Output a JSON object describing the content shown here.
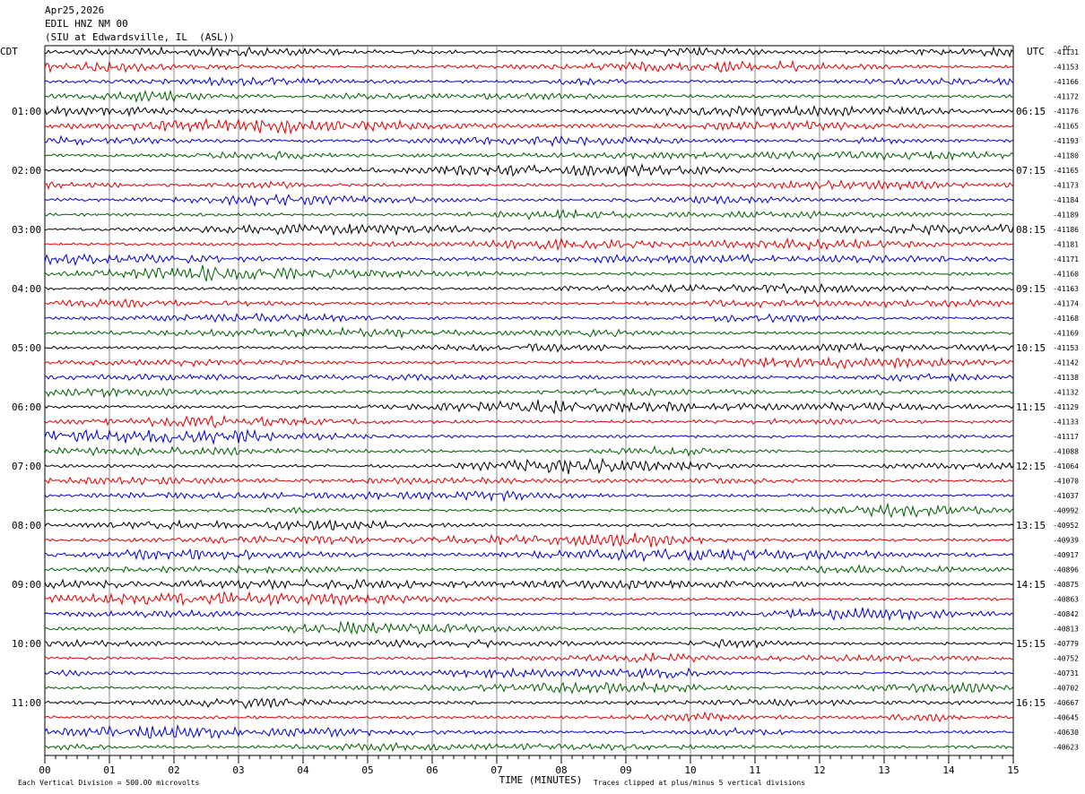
{
  "header": {
    "date": "Apr25,2026",
    "station": "EDIL HNZ NM 00",
    "location": "(SIU at Edwardsville, IL  (ASL))"
  },
  "chart_data": {
    "type": "line",
    "title": "",
    "xlabel": "TIME (MINUTES)",
    "ylabel": "",
    "left_timezone": "CDT",
    "right_timezone": "UTC",
    "dc_label": "DC",
    "x_ticks": [
      "00",
      "01",
      "02",
      "03",
      "04",
      "05",
      "06",
      "07",
      "08",
      "09",
      "10",
      "11",
      "12",
      "13",
      "14",
      "15"
    ],
    "xlim": [
      0,
      15
    ],
    "left_hour_labels": [
      "01:00",
      "02:00",
      "03:00",
      "04:00",
      "05:00",
      "06:00",
      "07:00",
      "08:00",
      "09:00",
      "10:00",
      "11:00"
    ],
    "right_hour_labels": [
      "06:15",
      "07:15",
      "08:15",
      "09:15",
      "10:15",
      "11:15",
      "12:15",
      "13:15",
      "14:15",
      "15:15",
      "16:15"
    ],
    "dc_offsets": [
      -41131,
      -41153,
      -41166,
      -41172,
      -41176,
      -41165,
      -41193,
      -41180,
      -41165,
      -41173,
      -41184,
      -41189,
      -41186,
      -41181,
      -41171,
      -41160,
      -41163,
      -41174,
      -41168,
      -41169,
      -41153,
      -41142,
      -41138,
      -41132,
      -41129,
      -41133,
      -41117,
      -41088,
      -41064,
      -41070,
      -41037,
      -40992,
      -40952,
      -40939,
      -40917,
      -40896,
      -40875,
      -40863,
      -40842,
      -40813,
      -40779,
      -40752,
      -40731,
      -40702,
      -40667,
      -40645,
      -40630,
      -40623
    ],
    "trace_colors": [
      "#000000",
      "#e00000",
      "#0000d0",
      "#006000"
    ],
    "grid": true,
    "footer_left": "Each Vertical Division =  500.00 microvolts",
    "footer_right": "Traces clipped at plus/minus 5 vertical divisions"
  }
}
